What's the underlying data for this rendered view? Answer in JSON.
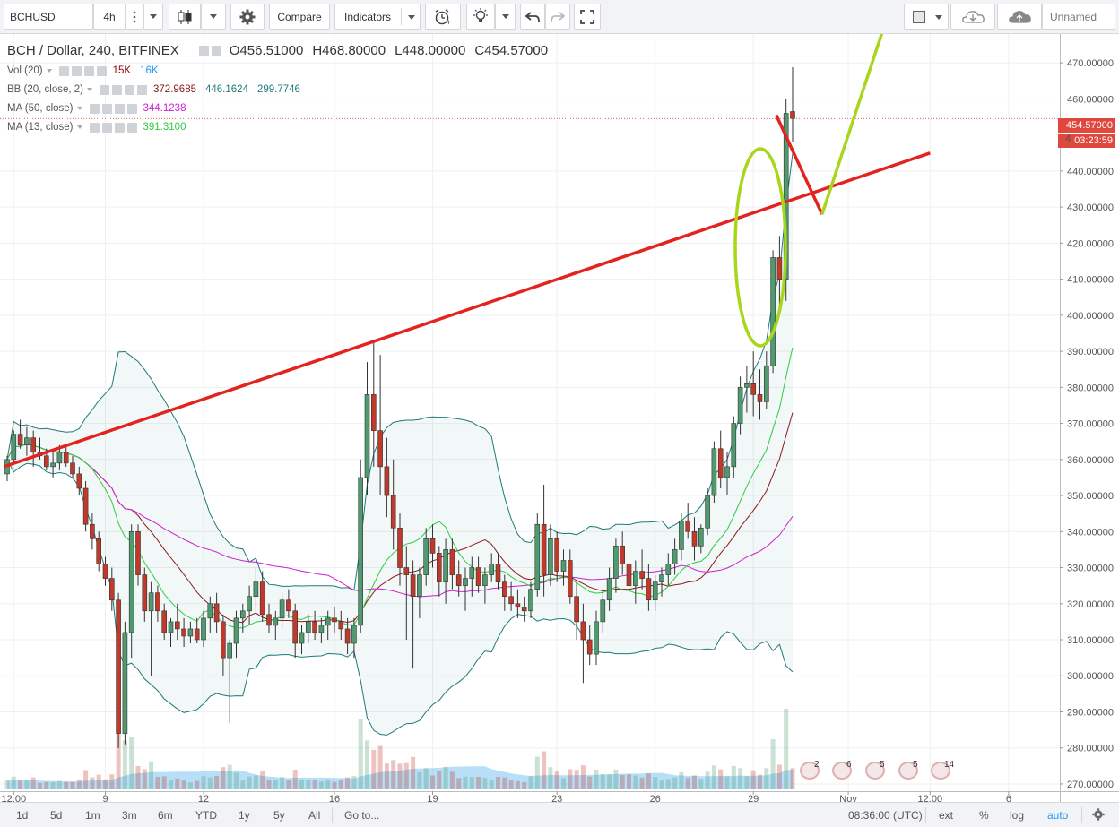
{
  "toolbar": {
    "symbol": "BCHUSD",
    "interval": "4h",
    "compare_label": "Compare",
    "indicators_label": "Indicators",
    "layout_name": "Unnamed"
  },
  "legend": {
    "title": "BCH / Dollar, 240, BITFINEX",
    "open": "O456.51000",
    "high": "H468.80000",
    "low": "L448.00000",
    "close": "C454.57000",
    "indicators": [
      {
        "label": "Vol (20)",
        "values": [
          "15K",
          "16K"
        ],
        "colors": [
          "#8b0000",
          "#2196f3"
        ]
      },
      {
        "label": "BB (20, close, 2)",
        "values": [
          "372.9685",
          "446.1624",
          "299.7746"
        ],
        "colors": [
          "#8b1a1a",
          "#1e7a78",
          "#1e7a78"
        ]
      },
      {
        "label": "MA (50, close)",
        "values": [
          "344.1238"
        ],
        "colors": [
          "#d01fd0"
        ]
      },
      {
        "label": "MA (13, close)",
        "values": [
          "391.3100"
        ],
        "colors": [
          "#2ecc40"
        ]
      }
    ]
  },
  "price_badges": {
    "last_price": "454.57000",
    "countdown": "03:23:59",
    "color": "#e0473d"
  },
  "y_axis": {
    "ticks": [
      "470.00000",
      "460.00000",
      "440.00000",
      "430.00000",
      "420.00000",
      "410.00000",
      "400.00000",
      "390.00000",
      "380.00000",
      "370.00000",
      "360.00000",
      "350.00000",
      "340.00000",
      "330.00000",
      "320.00000",
      "310.00000",
      "300.00000",
      "290.00000",
      "280.00000",
      "270.00000"
    ],
    "partial_label": "4"
  },
  "x_axis": {
    "ticks": [
      "12:00",
      "9",
      "12",
      "16",
      "19",
      "23",
      "26",
      "29",
      "Nov",
      "12:00",
      "6"
    ]
  },
  "events": [
    "2",
    "6",
    "5",
    "5",
    "14"
  ],
  "bottom": {
    "ranges": [
      "1d",
      "5d",
      "1m",
      "3m",
      "6m",
      "YTD",
      "1y",
      "5y",
      "All"
    ],
    "goto": "Go to...",
    "time": "08:36:00 (UTC)",
    "options": [
      "ext",
      "%",
      "log",
      "auto"
    ]
  },
  "colors": {
    "up": "#4f9a6f",
    "down": "#c0392b",
    "trendline": "#e3231f",
    "projection_up": "#a8d61a",
    "projection_down": "#e3231f",
    "ellipse": "#a8d61a",
    "bb_band": "#1e7a78",
    "bb_mid": "#8b1a1a",
    "ma50": "#d01fd0",
    "ma13": "#2ecc40",
    "volume_area": "#7cc4f0"
  },
  "chart_data": {
    "type": "candlestick",
    "title": "BCH / Dollar, 240, BITFINEX",
    "ylim": [
      268,
      478
    ],
    "x_ticks": [
      "12:00",
      "9",
      "12",
      "16",
      "19",
      "23",
      "26",
      "29",
      "Nov",
      "12:00",
      "6"
    ],
    "candles": [
      [
        356.0,
        361.0,
        354.0,
        360.0
      ],
      [
        360.0,
        368.0,
        359.0,
        367.0
      ],
      [
        367.0,
        371.0,
        363.0,
        364.0
      ],
      [
        364.0,
        369.0,
        361.0,
        366.0
      ],
      [
        366.0,
        368.0,
        358.0,
        362.0
      ],
      [
        362.0,
        366.0,
        360.0,
        361.0
      ],
      [
        361.0,
        363.0,
        357.0,
        358.0
      ],
      [
        358.0,
        362.0,
        355.0,
        359.0
      ],
      [
        359.0,
        364.0,
        357.0,
        362.0
      ],
      [
        362.0,
        364.0,
        358.0,
        359.0
      ],
      [
        359.0,
        361.0,
        355.0,
        356.0
      ],
      [
        356.0,
        358.0,
        350.0,
        352.0
      ],
      [
        352.0,
        354.0,
        340.0,
        342.0
      ],
      [
        342.0,
        345.0,
        335.0,
        338.0
      ],
      [
        338.0,
        340.0,
        329.0,
        331.0
      ],
      [
        331.0,
        333.0,
        325.0,
        327.0
      ],
      [
        327.0,
        330.0,
        318.0,
        321.0
      ],
      [
        321.0,
        323.0,
        280.0,
        284.0
      ],
      [
        284.0,
        315.0,
        281.0,
        312.0
      ],
      [
        312.0,
        342.0,
        305.0,
        340.0
      ],
      [
        340.0,
        342.0,
        325.0,
        328.0
      ],
      [
        328.0,
        330.0,
        315.0,
        318.0
      ],
      [
        318.0,
        326.0,
        300.0,
        323.0
      ],
      [
        323.0,
        325.0,
        315.0,
        318.0
      ],
      [
        318.0,
        320.0,
        310.0,
        312.0
      ],
      [
        312.0,
        316.0,
        308.0,
        315.0
      ],
      [
        315.0,
        320.0,
        310.0,
        313.0
      ],
      [
        313.0,
        316.0,
        308.0,
        311.0
      ],
      [
        311.0,
        315.0,
        309.0,
        313.0
      ],
      [
        313.0,
        316.0,
        309.0,
        310.0
      ],
      [
        310.0,
        318.0,
        308.0,
        316.0
      ],
      [
        316.0,
        322.0,
        312.0,
        320.0
      ],
      [
        320.0,
        323.0,
        312.0,
        315.0
      ],
      [
        315.0,
        317.0,
        300.0,
        305.0
      ],
      [
        305.0,
        310.0,
        287.0,
        309.0
      ],
      [
        309.0,
        318.0,
        305.0,
        316.0
      ],
      [
        316.0,
        320.0,
        312.0,
        318.0
      ],
      [
        318.0,
        325.0,
        314.0,
        322.0
      ],
      [
        322.0,
        330.0,
        318.0,
        326.0
      ],
      [
        326.0,
        329.0,
        315.0,
        317.0
      ],
      [
        317.0,
        320.0,
        312.0,
        314.0
      ],
      [
        314.0,
        318.0,
        310.0,
        316.0
      ],
      [
        316.0,
        323.0,
        313.0,
        321.0
      ],
      [
        321.0,
        324.0,
        316.0,
        318.0
      ],
      [
        318.0,
        320.0,
        305.0,
        309.0
      ],
      [
        309.0,
        314.0,
        306.0,
        312.0
      ],
      [
        312.0,
        317.0,
        309.0,
        315.0
      ],
      [
        315.0,
        318.0,
        310.0,
        312.0
      ],
      [
        312.0,
        316.0,
        309.0,
        314.0
      ],
      [
        314.0,
        318.0,
        310.0,
        316.0
      ],
      [
        316.0,
        319.0,
        312.0,
        315.0
      ],
      [
        315.0,
        318.0,
        310.0,
        313.0
      ],
      [
        313.0,
        316.0,
        306.0,
        309.0
      ],
      [
        309.0,
        316.0,
        305.0,
        314.0
      ],
      [
        314.0,
        360.0,
        312.0,
        355.0
      ],
      [
        355.0,
        387.0,
        350.0,
        378.0
      ],
      [
        378.0,
        393.0,
        358.0,
        368.0
      ],
      [
        368.0,
        389.0,
        350.0,
        358.0
      ],
      [
        358.0,
        366.0,
        344.0,
        350.0
      ],
      [
        350.0,
        360.0,
        335.0,
        341.0
      ],
      [
        341.0,
        345.0,
        325.0,
        330.0
      ],
      [
        330.0,
        336.0,
        310.0,
        328.0
      ],
      [
        328.0,
        332.0,
        302.0,
        322.0
      ],
      [
        322.0,
        330.0,
        316.0,
        328.0
      ],
      [
        328.0,
        341.0,
        325.0,
        338.0
      ],
      [
        338.0,
        342.0,
        330.0,
        334.0
      ],
      [
        334.0,
        336.0,
        322.0,
        326.0
      ],
      [
        326.0,
        338.0,
        320.0,
        335.0
      ],
      [
        335.0,
        338.0,
        324.0,
        328.0
      ],
      [
        328.0,
        332.0,
        322.0,
        325.0
      ],
      [
        325.0,
        330.0,
        318.0,
        327.0
      ],
      [
        327.0,
        333.0,
        322.0,
        330.0
      ],
      [
        330.0,
        333.0,
        323.0,
        325.0
      ],
      [
        325.0,
        330.0,
        320.0,
        328.0
      ],
      [
        328.0,
        334.0,
        326.0,
        331.0
      ],
      [
        331.0,
        334.0,
        324.0,
        326.0
      ],
      [
        326.0,
        328.0,
        318.0,
        322.0
      ],
      [
        322.0,
        326.0,
        318.0,
        320.0
      ],
      [
        320.0,
        324.0,
        316.0,
        319.0
      ],
      [
        319.0,
        322.0,
        315.0,
        318.0
      ],
      [
        318.0,
        326.0,
        316.0,
        324.0
      ],
      [
        324.0,
        345.0,
        322.0,
        342.0
      ],
      [
        342.0,
        353.0,
        322.0,
        328.0
      ],
      [
        328.0,
        342.0,
        325.0,
        338.0
      ],
      [
        338.0,
        340.0,
        326.0,
        329.0
      ],
      [
        329.0,
        335.0,
        325.0,
        332.0
      ],
      [
        332.0,
        335.0,
        320.0,
        322.0
      ],
      [
        322.0,
        326.0,
        310.0,
        315.0
      ],
      [
        315.0,
        320.0,
        298.0,
        310.0
      ],
      [
        310.0,
        314.0,
        303.0,
        306.0
      ],
      [
        306.0,
        318.0,
        303.0,
        315.0
      ],
      [
        315.0,
        324.0,
        312.0,
        321.0
      ],
      [
        321.0,
        330.0,
        318.0,
        327.0
      ],
      [
        327.0,
        338.0,
        323.0,
        336.0
      ],
      [
        336.0,
        340.0,
        328.0,
        331.0
      ],
      [
        331.0,
        334.0,
        322.0,
        325.0
      ],
      [
        325.0,
        332.0,
        320.0,
        329.0
      ],
      [
        329.0,
        335.0,
        324.0,
        327.0
      ],
      [
        327.0,
        331.0,
        318.0,
        321.0
      ],
      [
        321.0,
        328.0,
        318.0,
        326.0
      ],
      [
        326.0,
        330.0,
        322.0,
        328.0
      ],
      [
        328.0,
        334.0,
        325.0,
        331.0
      ],
      [
        331.0,
        338.0,
        328.0,
        335.0
      ],
      [
        335.0,
        345.0,
        332.0,
        343.0
      ],
      [
        343.0,
        348.0,
        338.0,
        340.0
      ],
      [
        340.0,
        344.0,
        332.0,
        336.0
      ],
      [
        336.0,
        342.0,
        334.0,
        341.0
      ],
      [
        341.0,
        352.0,
        339.0,
        350.0
      ],
      [
        350.0,
        365.0,
        348.0,
        363.0
      ],
      [
        363.0,
        368.0,
        352.0,
        355.0
      ],
      [
        355.0,
        362.0,
        350.0,
        358.0
      ],
      [
        358.0,
        372.0,
        355.0,
        370.0
      ],
      [
        370.0,
        383.0,
        367.0,
        380.0
      ],
      [
        380.0,
        386.0,
        373.0,
        381.0
      ],
      [
        381.0,
        390.0,
        372.0,
        378.0
      ],
      [
        378.0,
        385.0,
        371.0,
        376.0
      ],
      [
        376.0,
        390.0,
        374.0,
        386.0
      ],
      [
        386.0,
        418.0,
        384.0,
        416.0
      ],
      [
        416.0,
        422.0,
        400.0,
        410.0
      ],
      [
        410.0,
        460.0,
        404.0,
        456.0
      ],
      [
        456.5,
        468.8,
        448.0,
        454.57
      ]
    ],
    "volume_max": 50,
    "trendline": {
      "from": [
        -0.5,
        358
      ],
      "to": [
        141.0,
        445
      ]
    },
    "projection": {
      "path": [
        [
          117.5,
          455.5
        ],
        [
          124.5,
          428
        ],
        [
          134.5,
          492
        ]
      ]
    }
  }
}
